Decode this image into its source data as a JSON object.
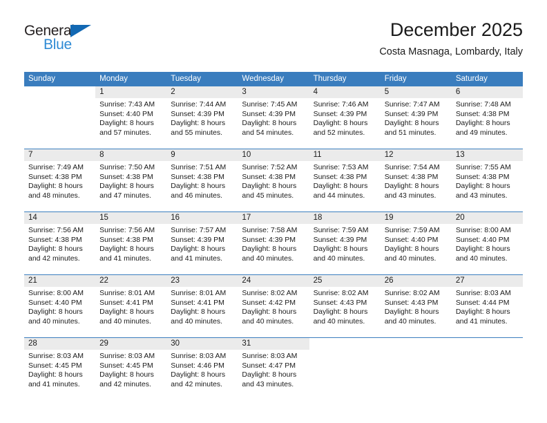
{
  "brand": {
    "word1": "General",
    "word2": "Blue",
    "triangle_color": "#1268b3",
    "word2_color": "#2e8ad4"
  },
  "header": {
    "title": "December 2025",
    "subtitle": "Costa Masnaga, Lombardy, Italy"
  },
  "theme": {
    "header_row_bg": "#3a7dbe",
    "header_row_text": "#ffffff",
    "daynum_bg": "#ebebeb",
    "divider": "#3a7dbe"
  },
  "weekdays": [
    "Sunday",
    "Monday",
    "Tuesday",
    "Wednesday",
    "Thursday",
    "Friday",
    "Saturday"
  ],
  "weeks": [
    [
      {
        "day": "",
        "sunrise": "",
        "sunset": "",
        "daylight1": "",
        "daylight2": ""
      },
      {
        "day": "1",
        "sunrise": "Sunrise: 7:43 AM",
        "sunset": "Sunset: 4:40 PM",
        "daylight1": "Daylight: 8 hours",
        "daylight2": "and 57 minutes."
      },
      {
        "day": "2",
        "sunrise": "Sunrise: 7:44 AM",
        "sunset": "Sunset: 4:39 PM",
        "daylight1": "Daylight: 8 hours",
        "daylight2": "and 55 minutes."
      },
      {
        "day": "3",
        "sunrise": "Sunrise: 7:45 AM",
        "sunset": "Sunset: 4:39 PM",
        "daylight1": "Daylight: 8 hours",
        "daylight2": "and 54 minutes."
      },
      {
        "day": "4",
        "sunrise": "Sunrise: 7:46 AM",
        "sunset": "Sunset: 4:39 PM",
        "daylight1": "Daylight: 8 hours",
        "daylight2": "and 52 minutes."
      },
      {
        "day": "5",
        "sunrise": "Sunrise: 7:47 AM",
        "sunset": "Sunset: 4:39 PM",
        "daylight1": "Daylight: 8 hours",
        "daylight2": "and 51 minutes."
      },
      {
        "day": "6",
        "sunrise": "Sunrise: 7:48 AM",
        "sunset": "Sunset: 4:38 PM",
        "daylight1": "Daylight: 8 hours",
        "daylight2": "and 49 minutes."
      }
    ],
    [
      {
        "day": "7",
        "sunrise": "Sunrise: 7:49 AM",
        "sunset": "Sunset: 4:38 PM",
        "daylight1": "Daylight: 8 hours",
        "daylight2": "and 48 minutes."
      },
      {
        "day": "8",
        "sunrise": "Sunrise: 7:50 AM",
        "sunset": "Sunset: 4:38 PM",
        "daylight1": "Daylight: 8 hours",
        "daylight2": "and 47 minutes."
      },
      {
        "day": "9",
        "sunrise": "Sunrise: 7:51 AM",
        "sunset": "Sunset: 4:38 PM",
        "daylight1": "Daylight: 8 hours",
        "daylight2": "and 46 minutes."
      },
      {
        "day": "10",
        "sunrise": "Sunrise: 7:52 AM",
        "sunset": "Sunset: 4:38 PM",
        "daylight1": "Daylight: 8 hours",
        "daylight2": "and 45 minutes."
      },
      {
        "day": "11",
        "sunrise": "Sunrise: 7:53 AM",
        "sunset": "Sunset: 4:38 PM",
        "daylight1": "Daylight: 8 hours",
        "daylight2": "and 44 minutes."
      },
      {
        "day": "12",
        "sunrise": "Sunrise: 7:54 AM",
        "sunset": "Sunset: 4:38 PM",
        "daylight1": "Daylight: 8 hours",
        "daylight2": "and 43 minutes."
      },
      {
        "day": "13",
        "sunrise": "Sunrise: 7:55 AM",
        "sunset": "Sunset: 4:38 PM",
        "daylight1": "Daylight: 8 hours",
        "daylight2": "and 43 minutes."
      }
    ],
    [
      {
        "day": "14",
        "sunrise": "Sunrise: 7:56 AM",
        "sunset": "Sunset: 4:38 PM",
        "daylight1": "Daylight: 8 hours",
        "daylight2": "and 42 minutes."
      },
      {
        "day": "15",
        "sunrise": "Sunrise: 7:56 AM",
        "sunset": "Sunset: 4:38 PM",
        "daylight1": "Daylight: 8 hours",
        "daylight2": "and 41 minutes."
      },
      {
        "day": "16",
        "sunrise": "Sunrise: 7:57 AM",
        "sunset": "Sunset: 4:39 PM",
        "daylight1": "Daylight: 8 hours",
        "daylight2": "and 41 minutes."
      },
      {
        "day": "17",
        "sunrise": "Sunrise: 7:58 AM",
        "sunset": "Sunset: 4:39 PM",
        "daylight1": "Daylight: 8 hours",
        "daylight2": "and 40 minutes."
      },
      {
        "day": "18",
        "sunrise": "Sunrise: 7:59 AM",
        "sunset": "Sunset: 4:39 PM",
        "daylight1": "Daylight: 8 hours",
        "daylight2": "and 40 minutes."
      },
      {
        "day": "19",
        "sunrise": "Sunrise: 7:59 AM",
        "sunset": "Sunset: 4:40 PM",
        "daylight1": "Daylight: 8 hours",
        "daylight2": "and 40 minutes."
      },
      {
        "day": "20",
        "sunrise": "Sunrise: 8:00 AM",
        "sunset": "Sunset: 4:40 PM",
        "daylight1": "Daylight: 8 hours",
        "daylight2": "and 40 minutes."
      }
    ],
    [
      {
        "day": "21",
        "sunrise": "Sunrise: 8:00 AM",
        "sunset": "Sunset: 4:40 PM",
        "daylight1": "Daylight: 8 hours",
        "daylight2": "and 40 minutes."
      },
      {
        "day": "22",
        "sunrise": "Sunrise: 8:01 AM",
        "sunset": "Sunset: 4:41 PM",
        "daylight1": "Daylight: 8 hours",
        "daylight2": "and 40 minutes."
      },
      {
        "day": "23",
        "sunrise": "Sunrise: 8:01 AM",
        "sunset": "Sunset: 4:41 PM",
        "daylight1": "Daylight: 8 hours",
        "daylight2": "and 40 minutes."
      },
      {
        "day": "24",
        "sunrise": "Sunrise: 8:02 AM",
        "sunset": "Sunset: 4:42 PM",
        "daylight1": "Daylight: 8 hours",
        "daylight2": "and 40 minutes."
      },
      {
        "day": "25",
        "sunrise": "Sunrise: 8:02 AM",
        "sunset": "Sunset: 4:43 PM",
        "daylight1": "Daylight: 8 hours",
        "daylight2": "and 40 minutes."
      },
      {
        "day": "26",
        "sunrise": "Sunrise: 8:02 AM",
        "sunset": "Sunset: 4:43 PM",
        "daylight1": "Daylight: 8 hours",
        "daylight2": "and 40 minutes."
      },
      {
        "day": "27",
        "sunrise": "Sunrise: 8:03 AM",
        "sunset": "Sunset: 4:44 PM",
        "daylight1": "Daylight: 8 hours",
        "daylight2": "and 41 minutes."
      }
    ],
    [
      {
        "day": "28",
        "sunrise": "Sunrise: 8:03 AM",
        "sunset": "Sunset: 4:45 PM",
        "daylight1": "Daylight: 8 hours",
        "daylight2": "and 41 minutes."
      },
      {
        "day": "29",
        "sunrise": "Sunrise: 8:03 AM",
        "sunset": "Sunset: 4:45 PM",
        "daylight1": "Daylight: 8 hours",
        "daylight2": "and 42 minutes."
      },
      {
        "day": "30",
        "sunrise": "Sunrise: 8:03 AM",
        "sunset": "Sunset: 4:46 PM",
        "daylight1": "Daylight: 8 hours",
        "daylight2": "and 42 minutes."
      },
      {
        "day": "31",
        "sunrise": "Sunrise: 8:03 AM",
        "sunset": "Sunset: 4:47 PM",
        "daylight1": "Daylight: 8 hours",
        "daylight2": "and 43 minutes."
      },
      {
        "day": "",
        "sunrise": "",
        "sunset": "",
        "daylight1": "",
        "daylight2": ""
      },
      {
        "day": "",
        "sunrise": "",
        "sunset": "",
        "daylight1": "",
        "daylight2": ""
      },
      {
        "day": "",
        "sunrise": "",
        "sunset": "",
        "daylight1": "",
        "daylight2": ""
      }
    ]
  ]
}
